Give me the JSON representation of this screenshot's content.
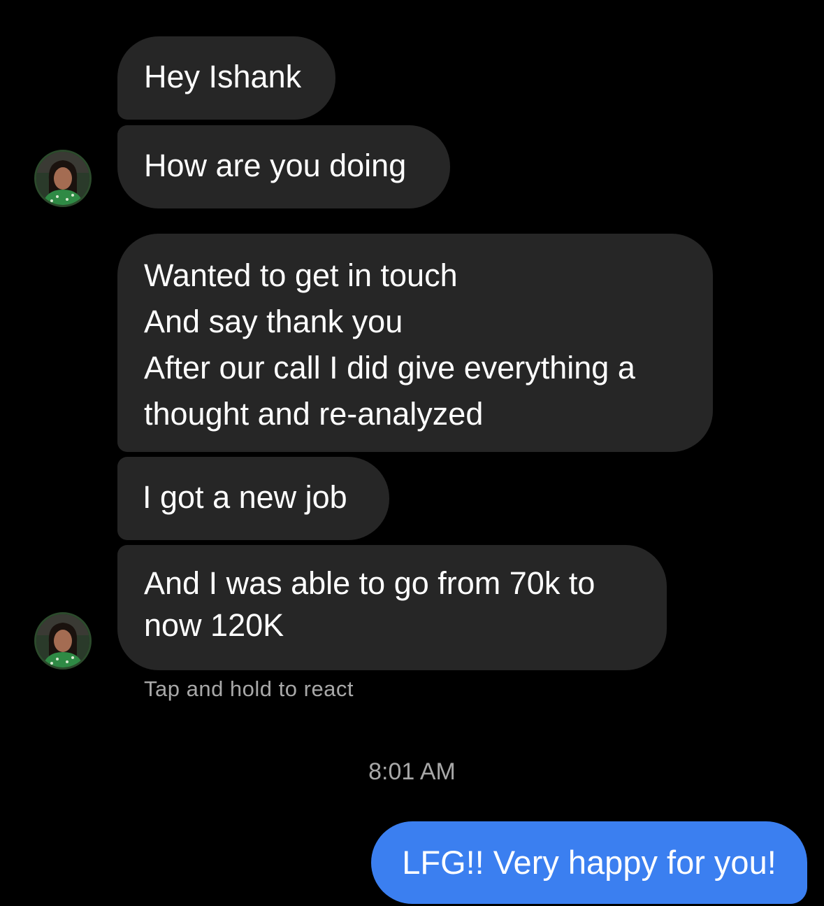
{
  "conversation": {
    "received": [
      {
        "lines": [
          "Hey Ishank"
        ]
      },
      {
        "lines": [
          "How are you doing"
        ]
      },
      {
        "lines": [
          "Wanted to get in touch",
          "And say thank you",
          "After our call I did give everything a",
          "thought and re-analyzed"
        ]
      },
      {
        "lines": [
          "I got a new job"
        ]
      },
      {
        "lines": [
          "And I was able to go from 70k to",
          "now 120K"
        ]
      }
    ],
    "reaction_hint": "Tap and hold to react",
    "timestamp": "8:01 AM",
    "sent": [
      {
        "text": "LFG!! Very happy for you!"
      }
    ]
  },
  "colors": {
    "background": "#000000",
    "received_bubble": "#262626",
    "sent_bubble": "#3b7ff0",
    "meta_text": "#a8a8a8"
  },
  "icons": {
    "avatar": "contact-avatar-photo"
  }
}
